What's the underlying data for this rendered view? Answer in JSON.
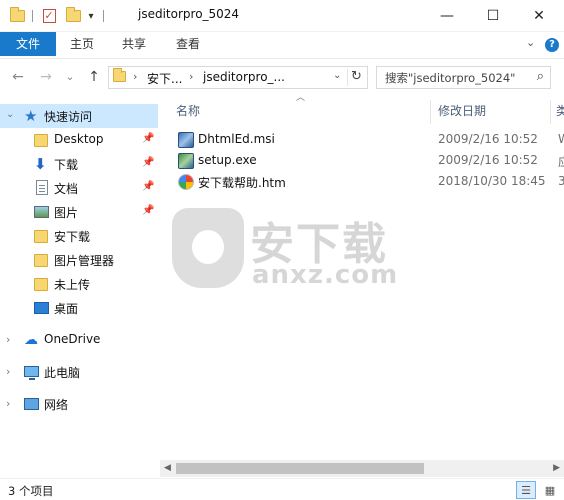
{
  "window": {
    "title": "jseditorpro_5024",
    "minimize_glyph": "—",
    "maximize_glyph": "☐",
    "close_glyph": "✕",
    "qa_dropdown_glyph": "▾"
  },
  "ribbon": {
    "tabs": [
      "文件",
      "主页",
      "共享",
      "查看"
    ],
    "collapse_glyph": "⌄",
    "help_glyph": "?"
  },
  "address": {
    "back_glyph": "←",
    "forward_glyph": "→",
    "recent_glyph": "⌄",
    "up_glyph": "↑",
    "crumbs": [
      "安下...",
      "jseditorpro_..."
    ],
    "separator_glyph": "›",
    "dropdown_glyph": "⌄",
    "refresh_glyph": "↻"
  },
  "search": {
    "placeholder": "搜索\"jseditorpro_5024\"",
    "icon_glyph": "⌕"
  },
  "nav": {
    "quick_access": {
      "label": "快速访问",
      "icon": "star-icon"
    },
    "pin_glyph": "📌",
    "items": [
      {
        "label": "Desktop",
        "icon": "folder-icon",
        "pinned": true
      },
      {
        "label": "下载",
        "icon": "download-icon",
        "pinned": true
      },
      {
        "label": "文档",
        "icon": "document-icon",
        "pinned": true
      },
      {
        "label": "图片",
        "icon": "pictures-icon",
        "pinned": true
      },
      {
        "label": "安下载",
        "icon": "folder-icon",
        "pinned": false
      },
      {
        "label": "图片管理器",
        "icon": "folder-icon",
        "pinned": false
      },
      {
        "label": "未上传",
        "icon": "folder-icon",
        "pinned": false
      },
      {
        "label": "桌面",
        "icon": "desktop-icon",
        "pinned": false
      }
    ],
    "roots": [
      {
        "label": "OneDrive",
        "icon": "onedrive-icon"
      },
      {
        "label": "此电脑",
        "icon": "this-pc-icon"
      },
      {
        "label": "网络",
        "icon": "network-icon"
      }
    ]
  },
  "columns": {
    "name": "名称",
    "modified": "修改日期",
    "type_partial": "类"
  },
  "files": [
    {
      "name": "DhtmlEd.msi",
      "modified": "2009/2/16 10:52",
      "type_partial": "W",
      "icon": "msi-file-icon"
    },
    {
      "name": "setup.exe",
      "modified": "2009/2/16 10:52",
      "type_partial": "应",
      "icon": "exe-file-icon"
    },
    {
      "name": "安下载帮助.htm",
      "modified": "2018/10/30 18:45",
      "type_partial": "3",
      "icon": "htm-file-icon"
    }
  ],
  "watermark": {
    "text": "安下载",
    "url": "anxz.com"
  },
  "status": {
    "item_count": "3 个项目"
  },
  "colors": {
    "file_tab": "#1979ca",
    "selection": "#cce8ff",
    "header_text": "#4c607a"
  }
}
